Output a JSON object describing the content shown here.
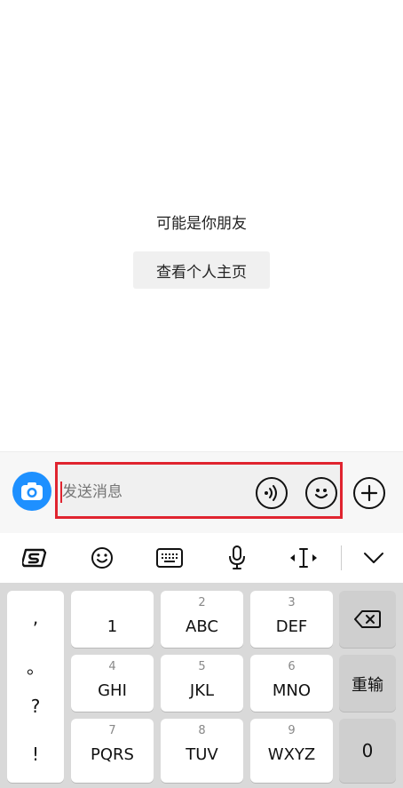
{
  "chat": {
    "hint": "可能是你朋友",
    "profile_button": "查看个人主页"
  },
  "input": {
    "placeholder": "发送消息"
  },
  "icons": {
    "camera": "camera-icon",
    "voice": "voice-icon",
    "emoji": "emoji-icon",
    "plus": "plus-icon"
  },
  "toolbar": {
    "items": [
      "sogou-logo-icon",
      "emoji-icon",
      "keyboard-icon",
      "microphone-icon",
      "cursor-move-icon",
      "chevron-down-icon"
    ]
  },
  "keyboard": {
    "symbols": [
      ",",
      "。",
      "?",
      "!"
    ],
    "keys": [
      {
        "num": "",
        "letters": "1"
      },
      {
        "num": "2",
        "letters": "ABC"
      },
      {
        "num": "3",
        "letters": "DEF"
      },
      {
        "num": "4",
        "letters": "GHI"
      },
      {
        "num": "5",
        "letters": "JKL"
      },
      {
        "num": "6",
        "letters": "MNO"
      },
      {
        "num": "7",
        "letters": "PQRS"
      },
      {
        "num": "8",
        "letters": "TUV"
      },
      {
        "num": "9",
        "letters": "WXYZ"
      }
    ],
    "retype": "重输",
    "zero": "0"
  },
  "colors": {
    "highlight": "#e0242f",
    "camera": "#1e90ff"
  }
}
